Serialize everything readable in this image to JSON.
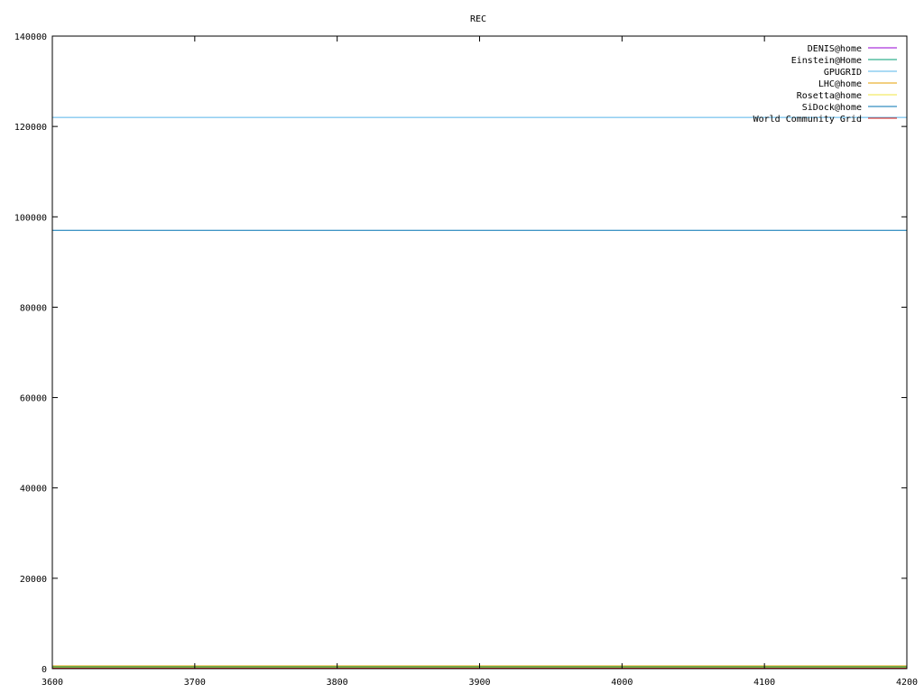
{
  "chart_data": {
    "type": "line",
    "title": "REC",
    "xlabel": "",
    "ylabel": "",
    "xlim": [
      3600,
      4200
    ],
    "ylim": [
      0,
      140000
    ],
    "xticks": [
      3600,
      3700,
      3800,
      3900,
      4000,
      4100,
      4200
    ],
    "yticks": [
      0,
      20000,
      40000,
      60000,
      80000,
      100000,
      120000,
      140000
    ],
    "grid": false,
    "legend_position": "top-right",
    "series": [
      {
        "name": "DENIS@home",
        "color": "#9400d3",
        "x": [
          3600,
          4200
        ],
        "y": [
          300,
          300
        ]
      },
      {
        "name": "Einstein@Home",
        "color": "#009e73",
        "x": [
          3600,
          4200
        ],
        "y": [
          400,
          400
        ]
      },
      {
        "name": "GPUGRID",
        "color": "#56b4e9",
        "x": [
          3600,
          4200
        ],
        "y": [
          122000,
          122000
        ]
      },
      {
        "name": "LHC@home",
        "color": "#e69f00",
        "x": [
          3600,
          4200
        ],
        "y": [
          600,
          600
        ]
      },
      {
        "name": "Rosetta@home",
        "color": "#f0e442",
        "x": [
          3600,
          4200
        ],
        "y": [
          200,
          200
        ]
      },
      {
        "name": "SiDock@home",
        "color": "#0072b2",
        "x": [
          3600,
          4200
        ],
        "y": [
          97000,
          97000
        ]
      },
      {
        "name": "World Community Grid",
        "color": "#e51e10",
        "x": [
          3600,
          4200
        ],
        "y": [
          100,
          100
        ]
      }
    ]
  }
}
